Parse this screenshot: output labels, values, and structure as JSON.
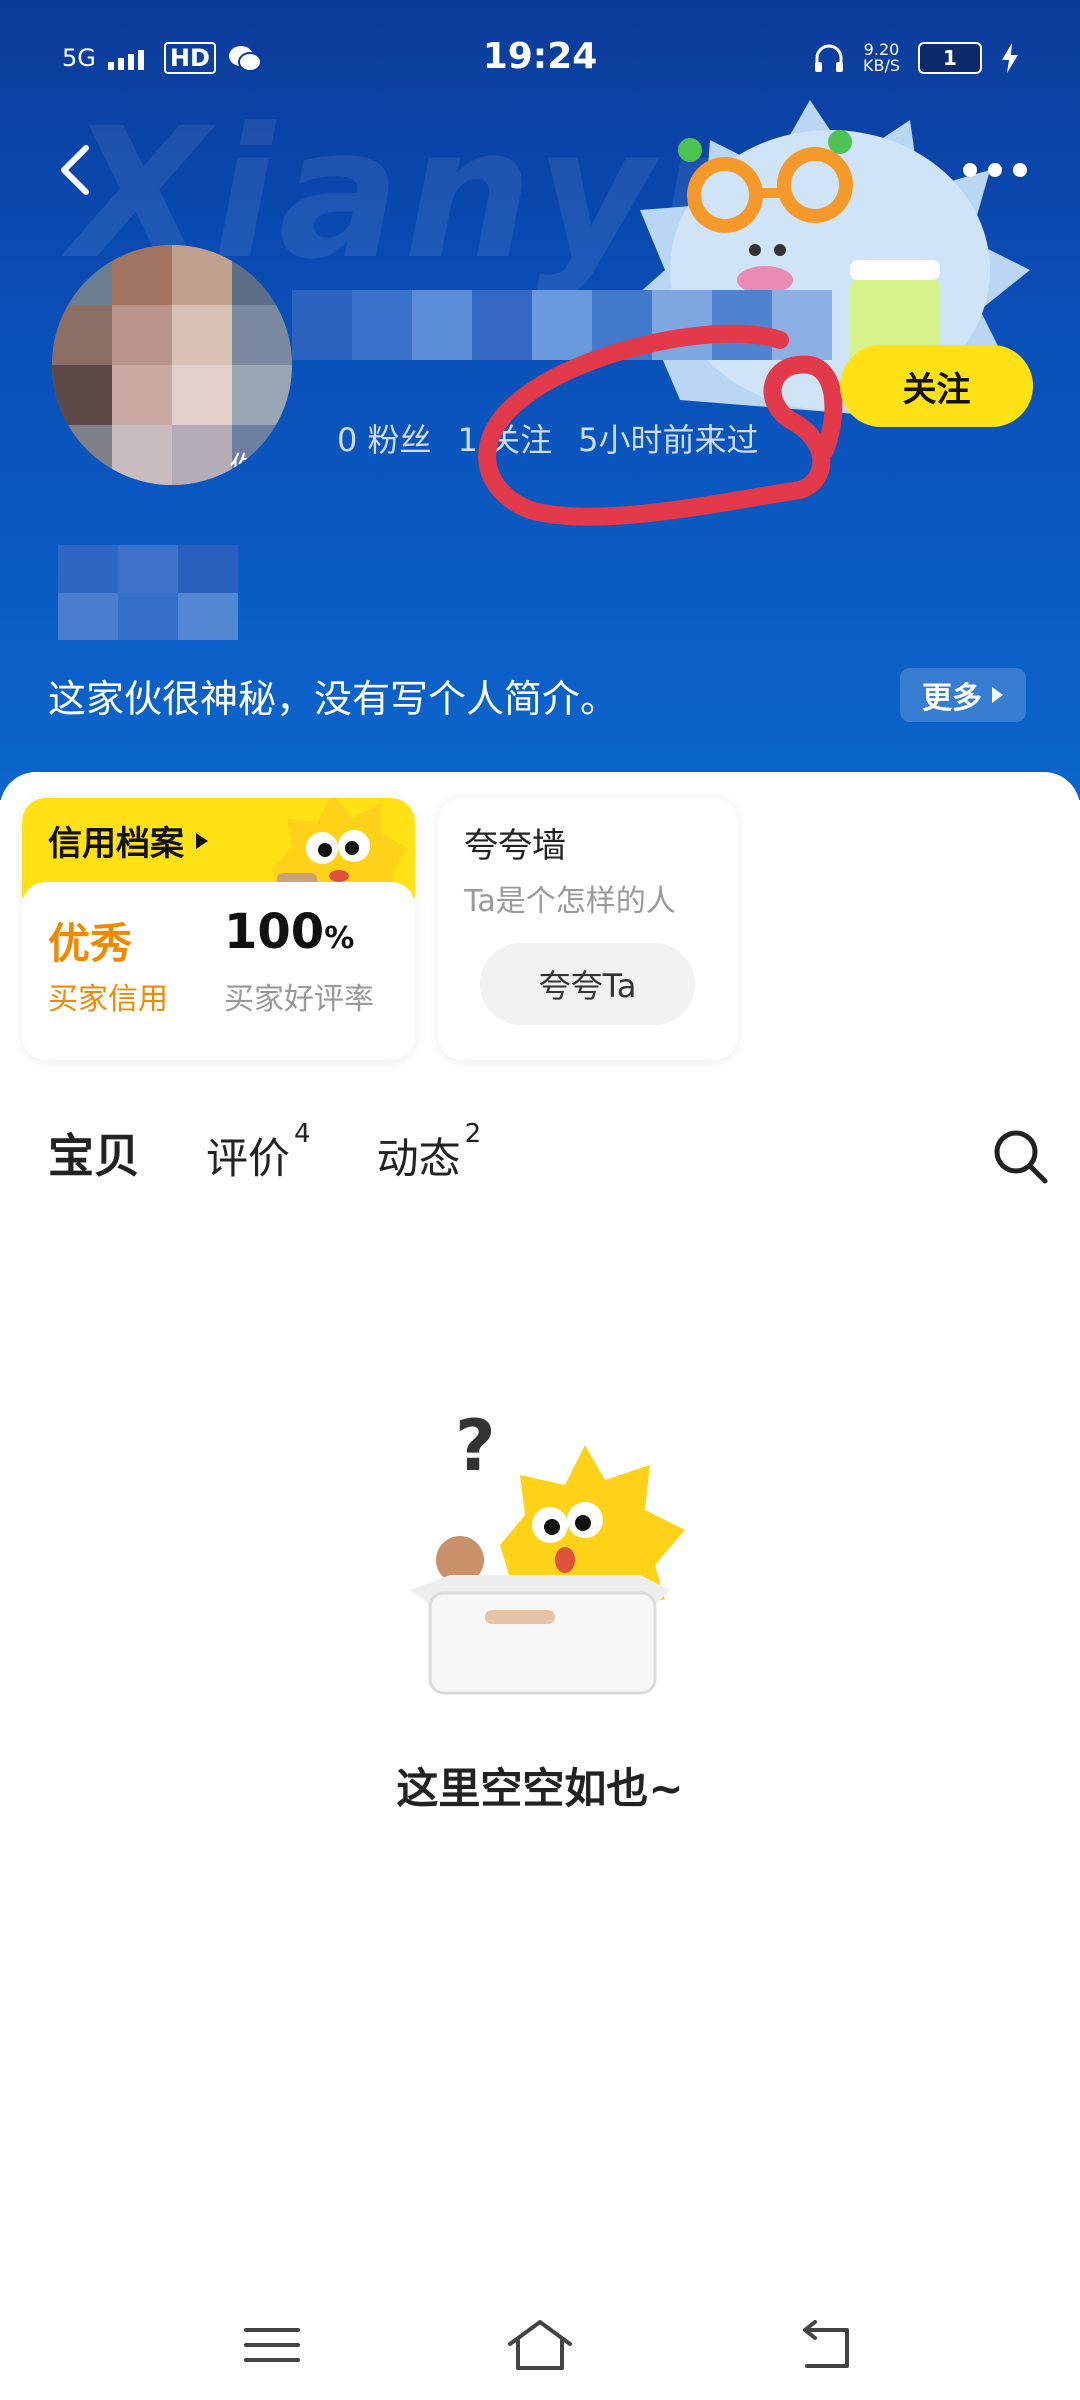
{
  "status_bar": {
    "network": "5G",
    "hd": "HD",
    "time": "19:24",
    "speed": "9.20",
    "speed_unit": "KB/S",
    "battery": "1"
  },
  "profile": {
    "avatar_text": "你",
    "stats": [
      "0 粉丝",
      "1 关注",
      "5小时前来过"
    ],
    "follow_label": "关注",
    "bio": "这家伙很神秘，没有写个人简介。",
    "more_label": "更多"
  },
  "credit": {
    "title": "信用档案",
    "credit_value": "优秀",
    "credit_label": "买家信用",
    "rate_value": "100",
    "rate_unit": "%",
    "rate_label": "买家好评率"
  },
  "praise": {
    "title": "夸夸墙",
    "subtitle": "Ta是个怎样的人",
    "button": "夸夸Ta"
  },
  "tabs": [
    {
      "label": "宝贝",
      "count": ""
    },
    {
      "label": "评价",
      "count": "4"
    },
    {
      "label": "动态",
      "count": "2"
    }
  ],
  "empty": {
    "message": "这里空空如也~"
  },
  "icons": {
    "back": "back-chevron-icon",
    "more": "more-dots-icon",
    "search": "search-icon",
    "nav_menu": "menu-icon",
    "nav_home": "home-icon",
    "nav_back": "return-icon"
  },
  "colors": {
    "header_blue": "#0b4fb8",
    "accent_yellow": "#ffe116",
    "credit_orange": "#f08a00",
    "annotation_red": "#e23a4a"
  }
}
